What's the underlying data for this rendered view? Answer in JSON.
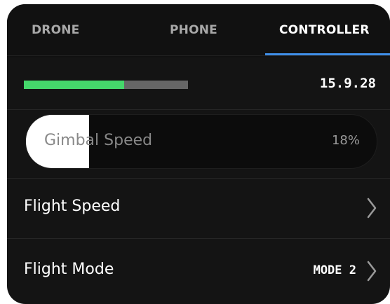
{
  "tabs": [
    {
      "label": "DRONE",
      "active": false
    },
    {
      "label": "PHONE",
      "active": false
    },
    {
      "label": "CONTROLLER",
      "active": true
    }
  ],
  "firmware": {
    "progress": 0.61,
    "version": "15.9.28"
  },
  "gimbal_speed": {
    "label": "Gimbal Speed",
    "value": "18%",
    "level": 0.18
  },
  "menu": [
    {
      "label": "Flight Speed",
      "value": "",
      "icon": "chevron-right-icon"
    },
    {
      "label": "Flight Mode",
      "value": "MODE 2",
      "icon": "chevron-right-icon"
    }
  ],
  "colors": {
    "background": "#141414",
    "accent": "#3f8ee8",
    "progress": "#45d76b",
    "track": "#666666"
  }
}
